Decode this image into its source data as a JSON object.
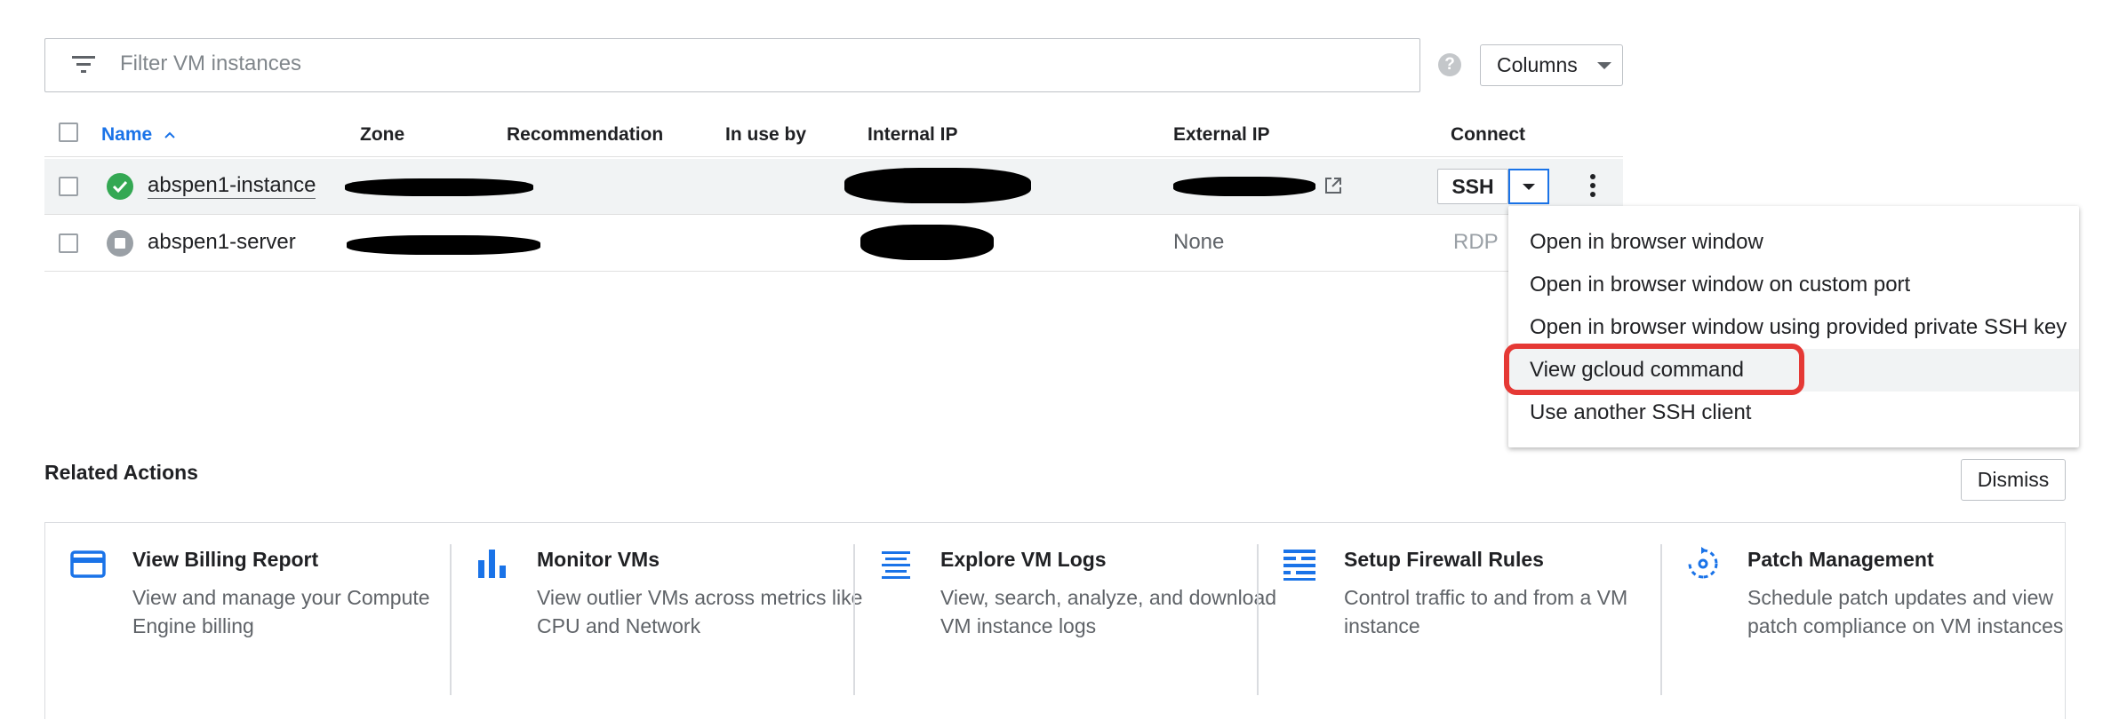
{
  "filter": {
    "placeholder": "Filter VM instances",
    "icon": "filter-icon"
  },
  "toolbar": {
    "help_icon": "help-icon",
    "help_glyph": "?",
    "columns_label": "Columns"
  },
  "table": {
    "headers": {
      "name": "Name",
      "zone": "Zone",
      "recommendation": "Recommendation",
      "in_use_by": "In use by",
      "internal_ip": "Internal IP",
      "external_ip": "External IP",
      "connect": "Connect"
    },
    "sort": "ascending",
    "rows": [
      {
        "name": "abspen1-instance",
        "status": "running",
        "status_icon": "check-circle-icon",
        "zone": "[redacted]",
        "internal_ip": "[redacted]",
        "external_ip": "[redacted]",
        "external_link_icon": "external-link-icon",
        "connect": "SSH"
      },
      {
        "name": "abspen1-server",
        "status": "stopped",
        "status_icon": "stop-circle-icon",
        "zone": "[redacted]",
        "internal_ip": "[redacted]",
        "external_ip": "None",
        "connect": "RDP"
      }
    ]
  },
  "ssh_menu": {
    "items": [
      "Open in browser window",
      "Open in browser window on custom port",
      "Open in browser window using provided private SSH key",
      "View gcloud command",
      "Use another SSH client"
    ],
    "highlighted_index": 3,
    "annotation_color": "#e53935"
  },
  "related": {
    "title": "Related Actions",
    "dismiss_label": "Dismiss",
    "cards": [
      {
        "icon": "credit-card-icon",
        "title": "View Billing Report",
        "desc": "View and manage your Compute Engine billing"
      },
      {
        "icon": "bar-chart-icon",
        "title": "Monitor VMs",
        "desc": "View outlier VMs across metrics like CPU and Network"
      },
      {
        "icon": "logs-icon",
        "title": "Explore VM Logs",
        "desc": "View, search, analyze, and download VM instance logs"
      },
      {
        "icon": "firewall-icon",
        "title": "Setup Firewall Rules",
        "desc": "Control traffic to and from a VM instance"
      },
      {
        "icon": "patch-cycle-icon",
        "title": "Patch Management",
        "desc": "Schedule patch updates and view patch compliance on VM instances"
      }
    ]
  },
  "colors": {
    "accent": "#1a73e8",
    "ok": "#34a853",
    "stopped": "#9aa0a6",
    "icon_blue": "#1a73e8"
  }
}
